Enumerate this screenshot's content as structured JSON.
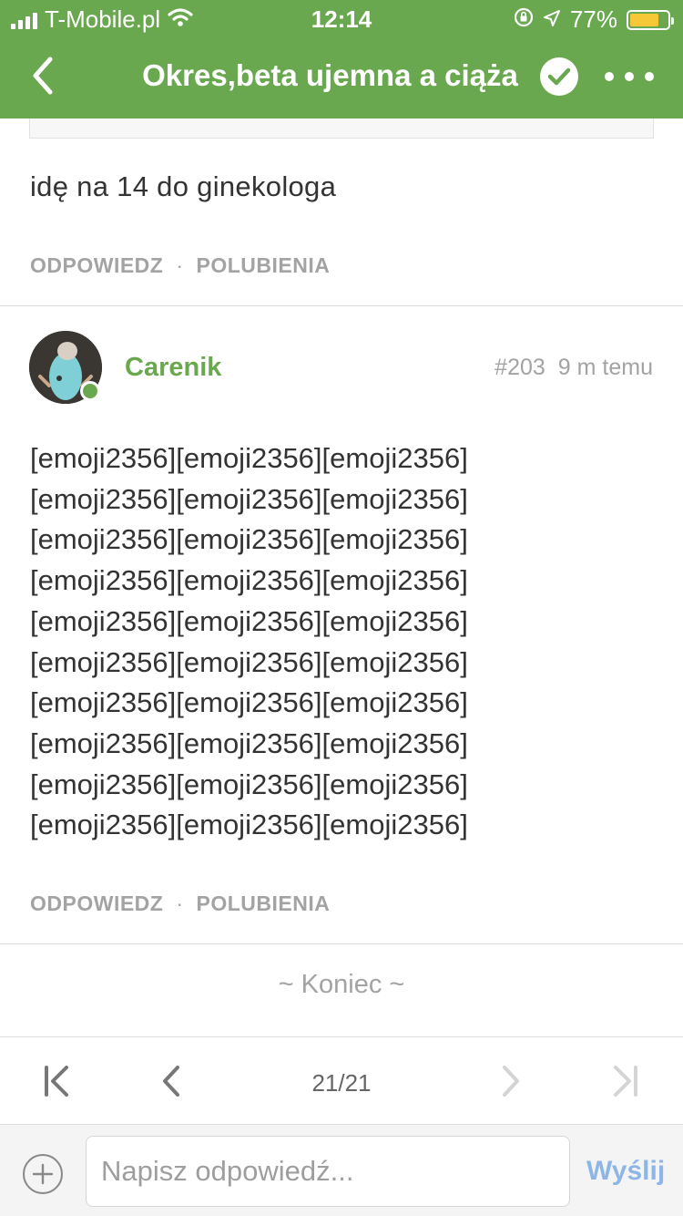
{
  "status_bar": {
    "carrier": "T-Mobile.pl",
    "time": "12:14",
    "battery_percent": "77%",
    "battery_level": 0.77
  },
  "nav": {
    "title": "Okres,beta ujemna a ciąża",
    "back_icon": "chevron-left-icon",
    "check_icon": "checkmark-icon",
    "more_icon": "more-dots-icon"
  },
  "previous_post": {
    "text": "idę na 14 do ginekologa",
    "actions": {
      "reply": "ODPOWIEDZ",
      "separator": "·",
      "likes": "POLUBIENIA"
    }
  },
  "post": {
    "author": "Carenik",
    "number": "#203",
    "time_ago": "9 m temu",
    "lines": [
      "[emoji2356][emoji2356][emoji2356]",
      "[emoji2356][emoji2356][emoji2356]",
      "[emoji2356][emoji2356][emoji2356]",
      "[emoji2356][emoji2356][emoji2356]",
      "[emoji2356][emoji2356][emoji2356]",
      "[emoji2356][emoji2356][emoji2356]",
      "[emoji2356][emoji2356][emoji2356]",
      "[emoji2356][emoji2356][emoji2356]",
      "[emoji2356][emoji2356][emoji2356]",
      "[emoji2356][emoji2356][emoji2356]"
    ],
    "actions": {
      "reply": "ODPOWIEDZ",
      "separator": "·",
      "likes": "POLUBIENIA"
    }
  },
  "end_label": "~ Koniec ~",
  "pagination": {
    "indicator": "21/21",
    "first_icon": "first-page-icon",
    "prev_icon": "chevron-left-icon",
    "next_icon": "chevron-right-icon",
    "last_icon": "last-page-icon"
  },
  "reply_bar": {
    "placeholder": "Napisz odpowiedź...",
    "send_label": "Wyślij",
    "add_icon": "plus-circle-icon"
  },
  "colors": {
    "brand_green": "#6aa84f",
    "battery_yellow": "#f6c736",
    "muted_gray": "#a3a3a3",
    "send_blue": "#8db6e6"
  }
}
